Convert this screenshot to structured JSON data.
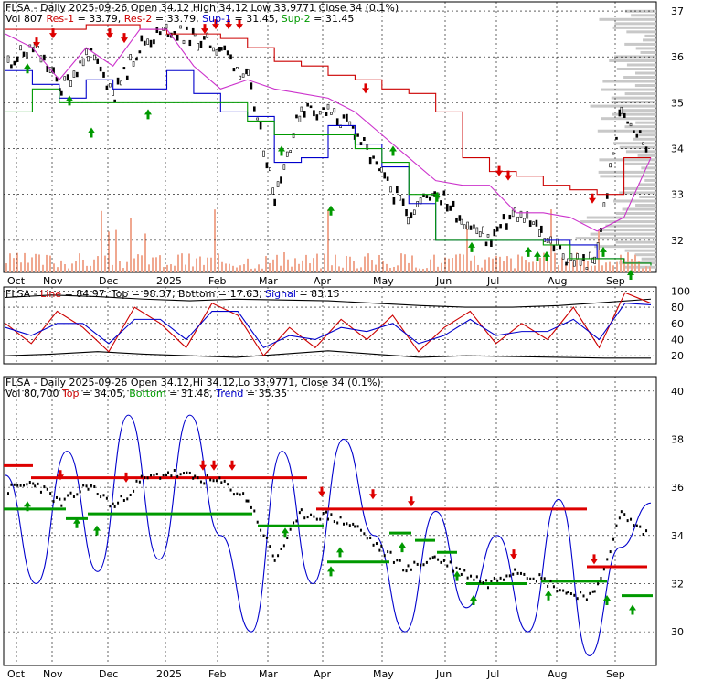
{
  "panels": {
    "top": {
      "line1": [
        {
          "text": "FLSA - Daily 2025-09-26 Open 34.12  High 34.12  Low 33.9771  Close 34 (0.1%)",
          "color": "#000000"
        }
      ],
      "line2": [
        {
          "text": "Vol 807 ",
          "color": "#000000"
        },
        {
          "text": "Res-1",
          "color": "#cc0000"
        },
        {
          "text": " = 33.79, ",
          "color": "#000000"
        },
        {
          "text": "Res-2",
          "color": "#cc0000"
        },
        {
          "text": " = 33.79, ",
          "color": "#000000"
        },
        {
          "text": "Sup-1",
          "color": "#0000cc"
        },
        {
          "text": " = 31.45, ",
          "color": "#000000"
        },
        {
          "text": "Sup-2",
          "color": "#009900"
        },
        {
          "text": " = 31.45",
          "color": "#000000"
        }
      ]
    },
    "middle": {
      "line1": [
        {
          "text": "FLSA - ",
          "color": "#000000"
        },
        {
          "text": "Line",
          "color": "#cc0000"
        },
        {
          "text": " = 84.97, ",
          "color": "#000000"
        },
        {
          "text": "Top",
          "color": "#000000"
        },
        {
          "text": " = 98.37, ",
          "color": "#000000"
        },
        {
          "text": "Bottom",
          "color": "#000000"
        },
        {
          "text": " = 17.63, ",
          "color": "#000000"
        },
        {
          "text": "Signal",
          "color": "#0000cc"
        },
        {
          "text": " = 83.15",
          "color": "#000000"
        }
      ]
    },
    "bottom": {
      "line1": [
        {
          "text": "FLSA - Daily 2025-09-26 Open 34.12,Hi 34.12,Lo 33.9771, Close 34 (0.1%)",
          "color": "#000000"
        }
      ],
      "line2": [
        {
          "text": "Vol 80,700 ",
          "color": "#000000"
        },
        {
          "text": "Top",
          "color": "#cc0000"
        },
        {
          "text": " = 34.05, ",
          "color": "#000000"
        },
        {
          "text": "Bottom",
          "color": "#009900"
        },
        {
          "text": " = 31.48, ",
          "color": "#000000"
        },
        {
          "text": "Trend",
          "color": "#0000cc"
        },
        {
          "text": " = 35.35",
          "color": "#000000"
        }
      ]
    }
  },
  "chart_data": [
    {
      "type": "line",
      "panel": "price-support-resistance",
      "x_labels": [
        "Oct",
        "Nov",
        "Dec",
        "2025",
        "Feb",
        "Mar",
        "Apr",
        "May",
        "Jun",
        "Jul",
        "Aug",
        "Sep"
      ],
      "y_ticks": [
        32,
        33,
        34,
        35,
        36,
        37
      ],
      "ylim": [
        31.3,
        37.2
      ],
      "close": [
        35.9,
        36.2,
        35.3,
        36.1,
        35.2,
        36.3,
        36.6,
        36.4,
        36.2,
        35.5,
        33.0,
        34.9,
        34.8,
        34.4,
        33.4,
        32.6,
        33.1,
        32.5,
        32.0,
        32.6,
        32.2,
        31.6,
        31.5,
        34.9,
        34.0
      ],
      "series": [
        {
          "name": "Res-1",
          "color": "#cc0000",
          "values": [
            36.6,
            36.6,
            36.6,
            36.7,
            36.7,
            36.6,
            36.5,
            36.5,
            36.4,
            36.2,
            35.9,
            35.8,
            35.6,
            35.5,
            35.3,
            35.2,
            34.8,
            33.8,
            33.5,
            33.4,
            33.2,
            33.1,
            33.0,
            33.8,
            33.8
          ]
        },
        {
          "name": "Res-2",
          "color": "#cc33cc",
          "values": [
            36.5,
            36.2,
            35.5,
            36.2,
            35.8,
            36.6,
            36.6,
            35.8,
            35.3,
            35.5,
            35.3,
            35.2,
            35.1,
            34.8,
            34.3,
            33.8,
            33.3,
            33.2,
            33.2,
            32.6,
            32.6,
            32.5,
            32.2,
            32.5,
            33.8
          ]
        },
        {
          "name": "Sup-1",
          "color": "#0000cc",
          "values": [
            35.7,
            35.4,
            35.1,
            35.5,
            35.3,
            35.3,
            35.7,
            35.2,
            34.8,
            34.7,
            33.7,
            33.8,
            34.5,
            34.1,
            33.6,
            32.8,
            32.0,
            32.0,
            32.0,
            32.0,
            32.0,
            31.9,
            31.6,
            31.5,
            31.45
          ]
        },
        {
          "name": "Sup-2",
          "color": "#009900",
          "values": [
            34.8,
            35.3,
            35.0,
            35.0,
            35.0,
            35.0,
            35.0,
            35.0,
            35.0,
            34.6,
            34.3,
            34.3,
            34.3,
            34.0,
            33.7,
            33.0,
            32.0,
            32.0,
            32.0,
            32.0,
            31.9,
            31.6,
            31.6,
            31.5,
            31.45
          ]
        }
      ]
    },
    {
      "type": "line",
      "panel": "oscillator",
      "y_ticks": [
        20,
        40,
        60,
        80,
        100
      ],
      "ylim": [
        10,
        105
      ],
      "series": [
        {
          "name": "Line",
          "color": "#cc0000",
          "values": [
            60,
            35,
            75,
            55,
            25,
            80,
            60,
            30,
            85,
            70,
            20,
            55,
            30,
            65,
            40,
            70,
            25,
            55,
            75,
            35,
            60,
            40,
            80,
            30,
            98,
            85
          ]
        },
        {
          "name": "Signal",
          "color": "#0000cc",
          "values": [
            55,
            45,
            60,
            60,
            35,
            65,
            65,
            40,
            75,
            75,
            30,
            45,
            40,
            55,
            50,
            60,
            35,
            45,
            65,
            45,
            50,
            50,
            65,
            40,
            85,
            83
          ]
        }
      ]
    },
    {
      "type": "line",
      "panel": "price-trend",
      "x_labels": [
        "Oct",
        "Nov",
        "Dec",
        "2025",
        "Feb",
        "Mar",
        "Apr",
        "May",
        "Jun",
        "Jul",
        "Aug",
        "Sep"
      ],
      "y_ticks": [
        30,
        32,
        34,
        36,
        38,
        40
      ],
      "ylim": [
        28.6,
        40.6
      ],
      "series": [
        {
          "name": "Trend",
          "color": "#0000cc",
          "values": [
            36.5,
            32.0,
            37.5,
            32.5,
            39.0,
            33.0,
            39.0,
            34.0,
            30.0,
            37.5,
            32.0,
            38.0,
            34.0,
            30.0,
            35.0,
            31.0,
            34.0,
            30.0,
            35.5,
            29.0,
            33.5,
            35.35
          ]
        }
      ]
    }
  ]
}
